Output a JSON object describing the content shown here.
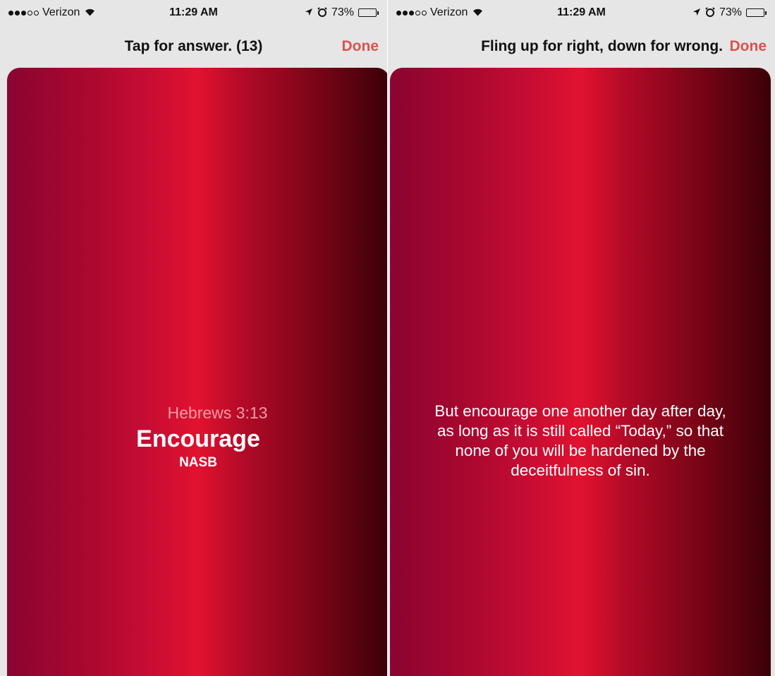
{
  "statusbar": {
    "carrier": "Verizon",
    "time": "11:29 AM",
    "battery": "73%",
    "battery_level": 0.73,
    "signal_bars": [
      true,
      true,
      true,
      false,
      false
    ],
    "icons": [
      "wifi-icon",
      "location-arrow-icon",
      "alarm-clock-icon",
      "battery-icon"
    ]
  },
  "left": {
    "nav_title": "Tap for answer. (13)",
    "done_label": "Done",
    "card": {
      "reference": "Hebrews 3:13",
      "title": "Encourage",
      "version": "NASB"
    }
  },
  "right": {
    "nav_title": "Fling up for right, down for wrong.",
    "done_label": "Done",
    "answer": "But encourage one another day after day,\nas long as it is still called “Today,” so that\nnone of you will be hardened by the\ndeceitfulness of sin."
  },
  "colors": {
    "accent": "#d9534f",
    "card_gradient": [
      "#8b0431",
      "#a5072f",
      "#c90d33",
      "#e1122f",
      "#b20a27",
      "#7c0517",
      "#3b0008"
    ],
    "bar_background": "#e6e6e6"
  }
}
